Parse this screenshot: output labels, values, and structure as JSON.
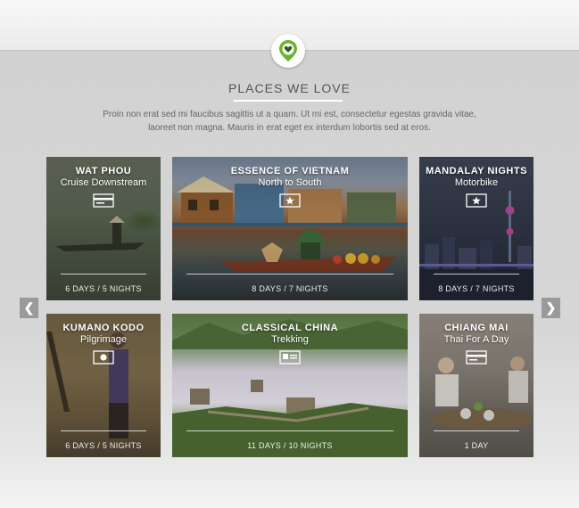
{
  "header": {
    "pin_icon": "location-pin-heart-icon",
    "accent": "#6ab32e",
    "title": "PLACES WE LOVE",
    "intro": "Proin non erat sed mi faucibus sagittis ut a quam. Ut mi est, consectetur egestas gravida vitae, laoreet non magna. Mauris in erat eget ex interdum lobortis sed at eros."
  },
  "carousel": {
    "prev_icon": "chevron-left-icon",
    "next_icon": "chevron-right-icon",
    "prev_glyph": "❮",
    "next_glyph": "❯"
  },
  "cards": [
    {
      "title": "WAT PHOU",
      "subtitle": "Cruise Downstream",
      "icon": "credit-card-icon",
      "duration": "6 DAYS / 5 NIGHTS"
    },
    {
      "title": "ESSENCE OF VIETNAM",
      "subtitle": "North to South",
      "icon": "star-badge-icon",
      "duration": "8 DAYS / 7 NIGHTS"
    },
    {
      "title": "MANDALAY NIGHTS",
      "subtitle": "Motorbike",
      "icon": "star-badge-icon",
      "duration": "8 DAYS / 7 NIGHTS"
    },
    {
      "title": "KUMANO KODO",
      "subtitle": "Pilgrimage",
      "icon": "camera-icon",
      "duration": "6 DAYS / 5 NIGHTS"
    },
    {
      "title": "CLASSICAL CHINA",
      "subtitle": "Trekking",
      "icon": "id-card-icon",
      "duration": "11 DAYS / 10 NIGHTS"
    },
    {
      "title": "CHIANG MAI",
      "subtitle": "Thai For A Day",
      "icon": "credit-card-icon",
      "duration": "1 DAY"
    }
  ]
}
